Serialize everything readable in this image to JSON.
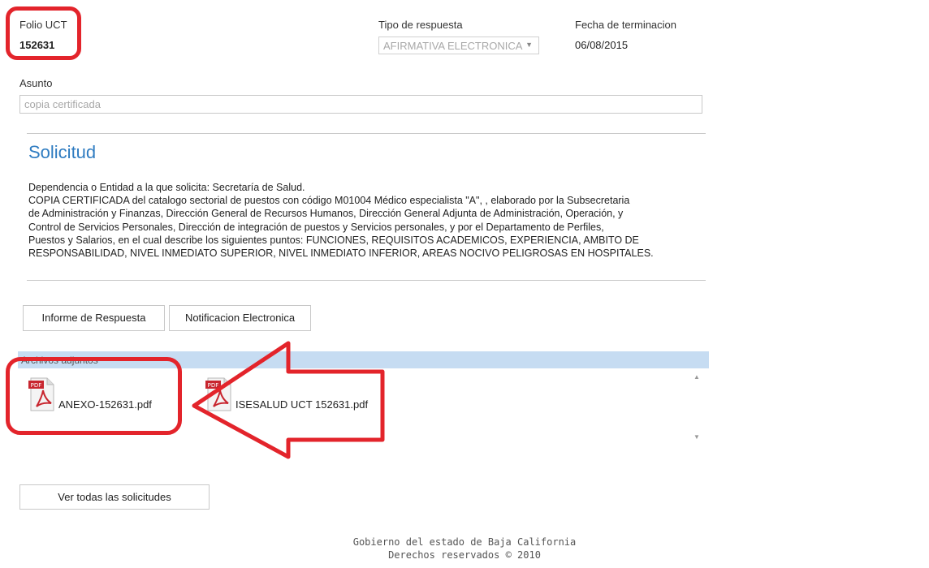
{
  "header": {
    "folio_label": "Folio UCT",
    "folio_value": "152631",
    "tipo_label": "Tipo de respuesta",
    "tipo_value": "AFIRMATIVA ELECTRONICA",
    "fecha_label": "Fecha de terminacion",
    "fecha_value": "06/08/2015"
  },
  "asunto": {
    "label": "Asunto",
    "placeholder": "copia certificada"
  },
  "solicitud": {
    "title": "Solicitud",
    "lines": [
      "Dependencia o Entidad a la que solicita: Secretaría de Salud.",
      "COPIA CERTIFICADA del catalogo sectorial de puestos con código M01004 Médico especialista \"A\", , elaborado por la Subsecretaria",
      "de Administración y Finanzas, Dirección General de Recursos Humanos, Dirección General Adjunta de Administración, Operación, y",
      "Control de Servicios Personales, Dirección de integración de puestos y Servicios personales, y por el Departamento de Perfiles,",
      "Puestos y Salarios, en el cual describe los siguientes puntos: FUNCIONES, REQUISITOS ACADEMICOS, EXPERIENCIA, AMBITO DE",
      "RESPONSABILIDAD, NIVEL INMEDIATO SUPERIOR, NIVEL INMEDIATO INFERIOR, AREAS NOCIVO PELIGROSAS EN HOSPITALES."
    ]
  },
  "buttons": {
    "informe": "Informe de Respuesta",
    "notificacion": "Notificacion Electronica",
    "ver_todas": "Ver todas las solicitudes"
  },
  "attachments": {
    "header": "Archivos adjuntos",
    "files": [
      {
        "name": "ANEXO-152631.pdf",
        "icon": "pdf-icon",
        "icon_label": "PDF"
      },
      {
        "name": "ISESALUD UCT 152631.pdf",
        "icon": "pdf-icon",
        "icon_label": "PDF"
      }
    ]
  },
  "annotations": {
    "highlight_color": "#e3242b"
  },
  "footer": {
    "line1": "Gobierno del estado de Baja California",
    "line2": "Derechos reservados © 2010"
  }
}
